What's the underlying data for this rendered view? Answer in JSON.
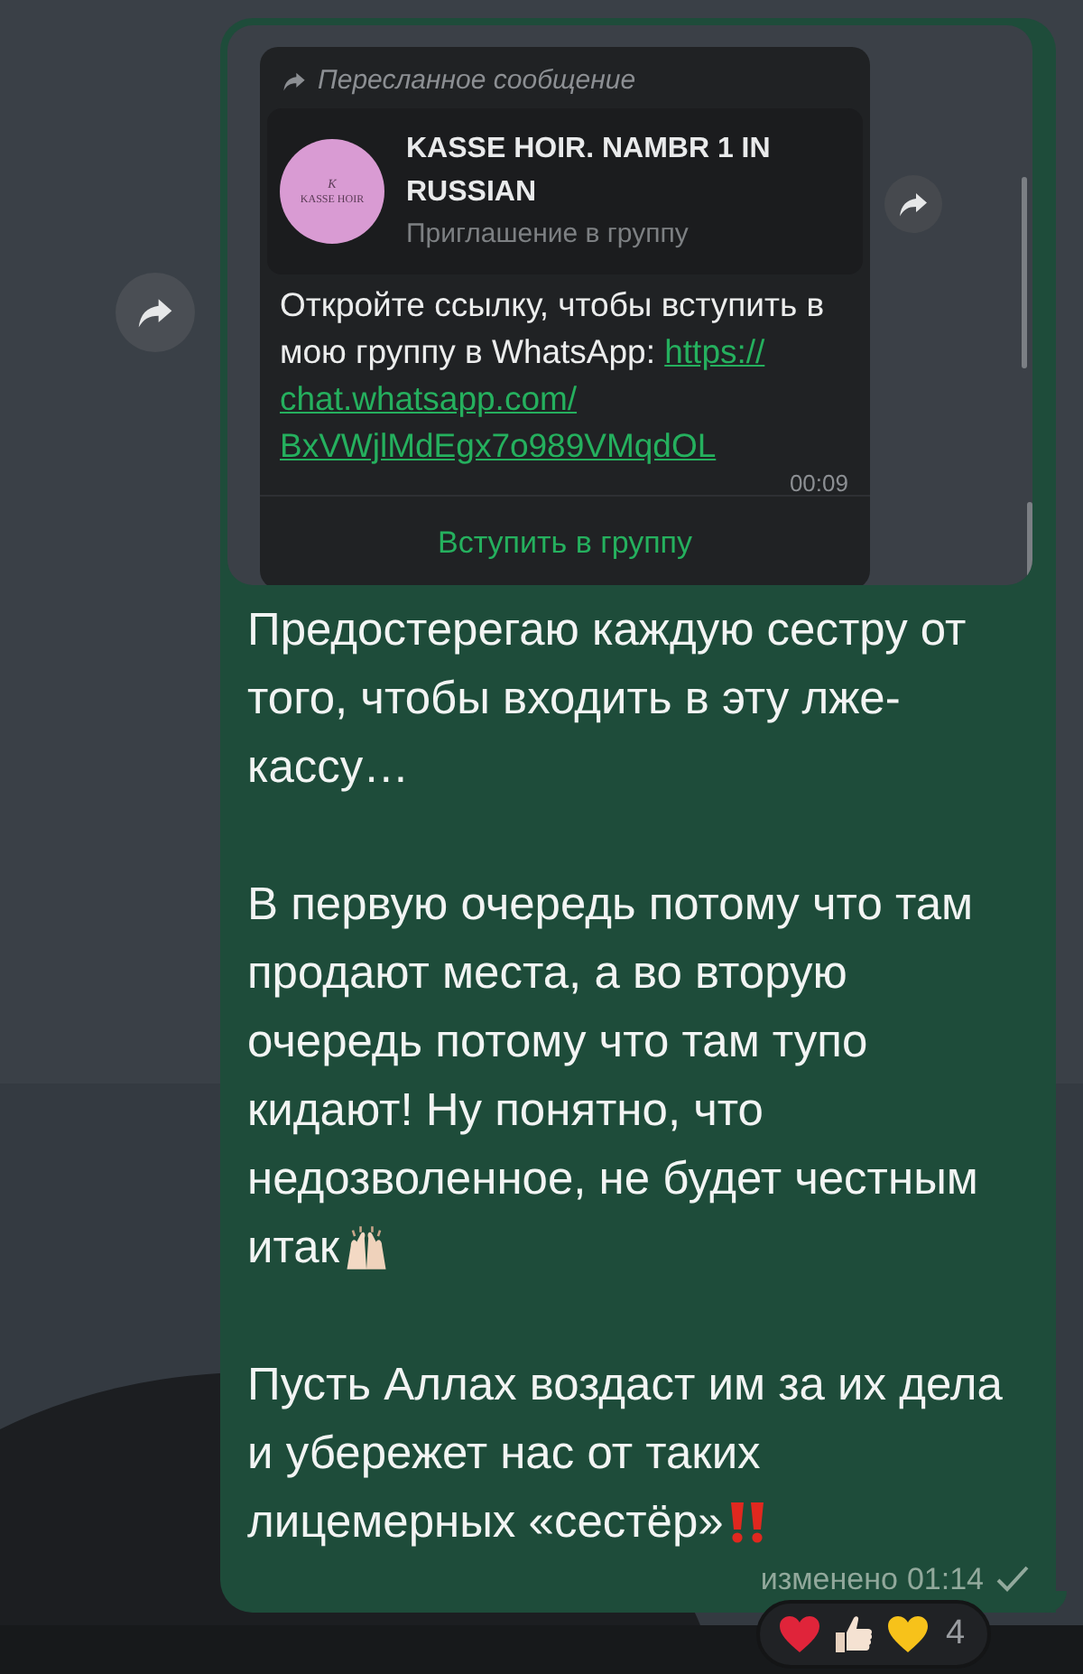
{
  "forwarded_card": {
    "label": "Пересланное сообщение",
    "avatar_initials": "K",
    "avatar_label": "KASSE HOIR",
    "group_name": "KASSE HOIR. NAMBR 1 IN RUSSIAN",
    "group_subtitle": "Приглашение в группу",
    "text": "Откройте ссылку, чтобы вступить в мою группу в WhatsApp: ",
    "link_lines": [
      "https://",
      "chat.whatsapp.com/",
      "BxVWjlMdEgx7o989VMqdOL"
    ],
    "time": "00:09",
    "join_button": "Вступить в группу"
  },
  "message": {
    "paragraphs": [
      {
        "kind": "plain",
        "text": "Предостерегаю каждую сестру от того, чтобы входить в эту лже-кассу…"
      },
      {
        "kind": "hands",
        "text": "В первую очередь потому что там продают места, а во вторую очередь потому что там тупо кидают! Ну понятно, что недозволенное, не будет честным",
        "last_line": "итак"
      },
      {
        "kind": "alarm",
        "text": "Пусть Аллах воздаст им за их дела и убережет нас от таких",
        "last_line": "лицемерных «сестёр»"
      }
    ],
    "edited_label": "изменено",
    "time": "01:14",
    "read": false
  },
  "reactions": {
    "items": [
      {
        "kind": "heart",
        "color": "#e0243a"
      },
      {
        "kind": "thumbs"
      },
      {
        "kind": "heart",
        "color": "#f7c21a"
      }
    ],
    "count": "4"
  }
}
